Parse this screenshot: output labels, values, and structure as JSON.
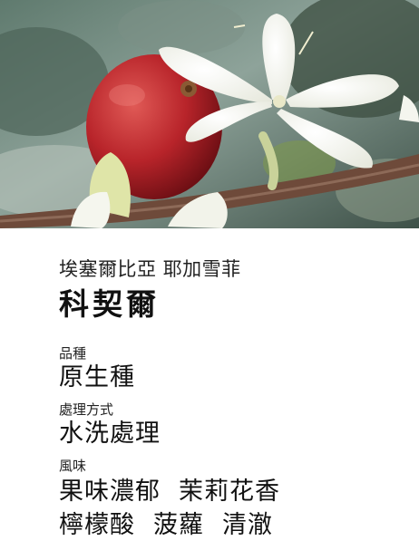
{
  "photo": {
    "subject": "coffee-cherry-and-blossom",
    "colors": {
      "cherry": "#b8242a",
      "blossom": "#f7f7f2",
      "branch": "#6e4a3a",
      "leaf": "#6f8a6a"
    }
  },
  "coffee": {
    "region": "埃塞爾比亞 耶加雪菲",
    "name": "科契爾",
    "variety": {
      "label": "品種",
      "value": "原生種"
    },
    "process": {
      "label": "處理方式",
      "value": "水洗處理"
    },
    "flavor": {
      "label": "風味",
      "notes": [
        [
          "果味濃郁",
          "茉莉花香"
        ],
        [
          "檸檬酸",
          "菠蘿",
          "清澈"
        ]
      ]
    }
  }
}
